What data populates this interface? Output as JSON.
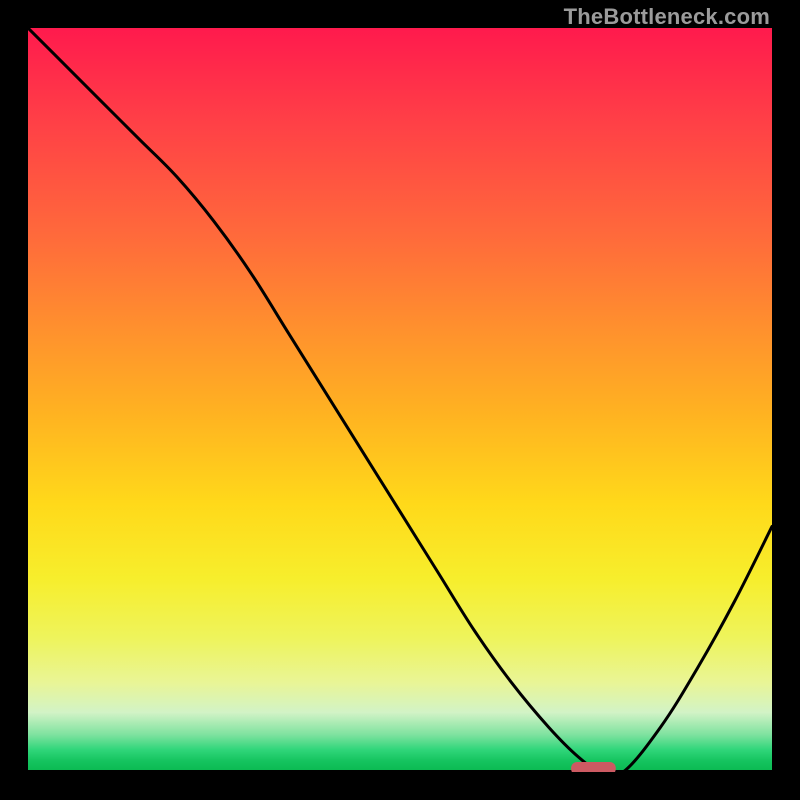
{
  "watermark": "TheBottleneck.com",
  "chart_data": {
    "type": "line",
    "title": "",
    "xlabel": "",
    "ylabel": "",
    "xlim": [
      0,
      100
    ],
    "ylim": [
      0,
      100
    ],
    "grid": false,
    "x": [
      0,
      5,
      10,
      15,
      20,
      25,
      30,
      35,
      40,
      45,
      50,
      55,
      60,
      65,
      70,
      74,
      77,
      80,
      85,
      90,
      95,
      100
    ],
    "values": [
      100,
      95,
      90,
      85,
      80,
      74,
      67,
      59,
      51,
      43,
      35,
      27,
      19,
      12,
      6,
      2,
      0,
      0,
      6,
      14,
      23,
      33
    ],
    "marker": {
      "x_start": 73,
      "x_end": 79,
      "y": 0,
      "color": "#CC5A62"
    },
    "gradient_colors": {
      "top": "#FF1A4D",
      "mid": "#FFD91A",
      "bottom": "#0AB850"
    }
  }
}
